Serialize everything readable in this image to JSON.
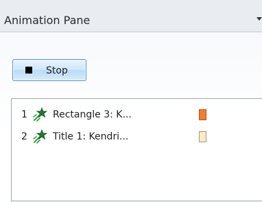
{
  "pane": {
    "title": "Animation Pane",
    "menu_icon": "dropdown-arrow-icon"
  },
  "toolbar": {
    "stop_label": "Stop",
    "stop_icon": "stop-square-icon"
  },
  "animations": [
    {
      "number": "1",
      "icon": "entrance-effect-star-icon",
      "label": "Rectangle 3: K...",
      "bar_color": "#f47b30",
      "bar_border": "#b5541a"
    },
    {
      "number": "2",
      "icon": "entrance-effect-star-icon",
      "label": "Title 1: Kendri...",
      "bar_color": "#fde9c7",
      "bar_border": "#a7967a"
    }
  ],
  "colors": {
    "timeline": "#5b9bd5",
    "button_border": "#5a90c6"
  }
}
